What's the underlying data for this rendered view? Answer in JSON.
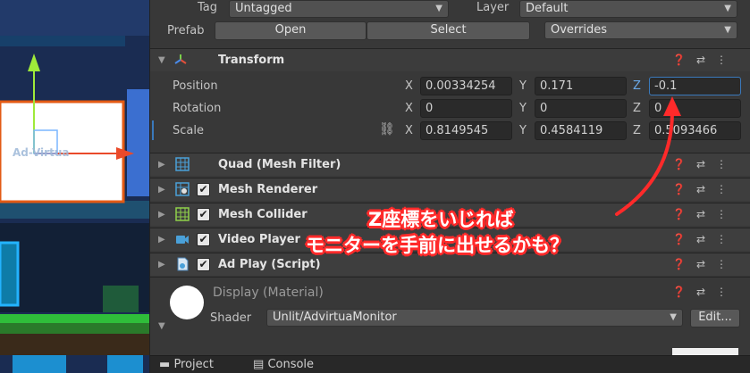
{
  "header": {
    "tag_label": "Tag",
    "tag_value": "Untagged",
    "layer_label": "Layer",
    "layer_value": "Default",
    "prefab_label": "Prefab",
    "open_button": "Open",
    "select_button": "Select",
    "overrides_value": "Overrides"
  },
  "transform": {
    "title": "Transform",
    "position": {
      "label": "Position",
      "x": "0.00334254",
      "y": "0.171",
      "z": "-0.1"
    },
    "rotation": {
      "label": "Rotation",
      "x": "0",
      "y": "0",
      "z": "0"
    },
    "scale": {
      "label": "Scale",
      "x": "0.8149545",
      "y": "0.4584119",
      "z": "0.5093466"
    },
    "axis_x": "X",
    "axis_y": "Y",
    "axis_z": "Z"
  },
  "components": [
    {
      "title": "Quad (Mesh Filter)",
      "icon": "mesh-filter-icon",
      "checked": null
    },
    {
      "title": "Mesh Renderer",
      "icon": "mesh-renderer-icon",
      "checked": "✔"
    },
    {
      "title": "Mesh Collider",
      "icon": "mesh-collider-icon",
      "checked": "✔"
    },
    {
      "title": "Video Player",
      "icon": "video-player-icon",
      "checked": "✔"
    },
    {
      "title": "Ad Play (Script)",
      "icon": "script-icon",
      "checked": "✔"
    }
  ],
  "material": {
    "name": "Display (Material)",
    "shader_label": "Shader",
    "shader_value": "Unlit/AdvirtuaMonitor",
    "edit_button": "Edit..."
  },
  "scene": {
    "watermark": "Ad-Virtua"
  },
  "annotation": {
    "line1": "Z座標をいじれば",
    "line2": "モニターを手前に出せるかも？"
  },
  "bottom_tabs": {
    "project": "Project",
    "console": "Console"
  },
  "colors": {
    "accent_blue": "#3a79bb",
    "annotation_red": "#ff2a2a",
    "panel_bg": "#383838"
  }
}
